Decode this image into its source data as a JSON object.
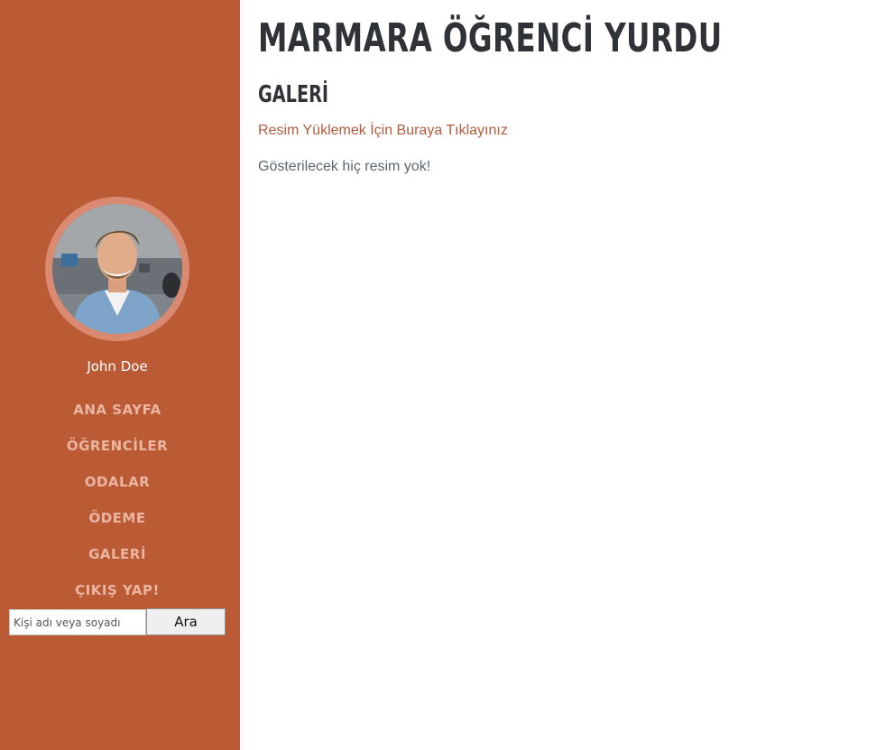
{
  "sidebar": {
    "user_name": "John Doe",
    "nav": [
      {
        "label": "ANA SAYFA"
      },
      {
        "label": "ÖĞRENCİLER"
      },
      {
        "label": "ODALAR"
      },
      {
        "label": "ÖDEME"
      },
      {
        "label": "GALERİ"
      },
      {
        "label": "ÇIKIŞ YAP!"
      }
    ],
    "search": {
      "placeholder": "Kişi adı veya soyadı",
      "value": "",
      "button_label": "Ara"
    }
  },
  "main": {
    "site_title": "MARMARA ÖĞRENCİ YURDU",
    "page_title": "GALERİ",
    "upload_link": "Resim Yüklemek İçin Buraya Tıklayınız",
    "empty_message": "Gösterilecek hiç resim yok!"
  },
  "colors": {
    "sidebar_bg": "#bb5b36",
    "nav_text": "#eab5a1",
    "title_text": "#2f3338",
    "link_text": "#b35a3a",
    "muted_text": "#5b6670"
  },
  "icons": {
    "avatar": "user-photo"
  }
}
